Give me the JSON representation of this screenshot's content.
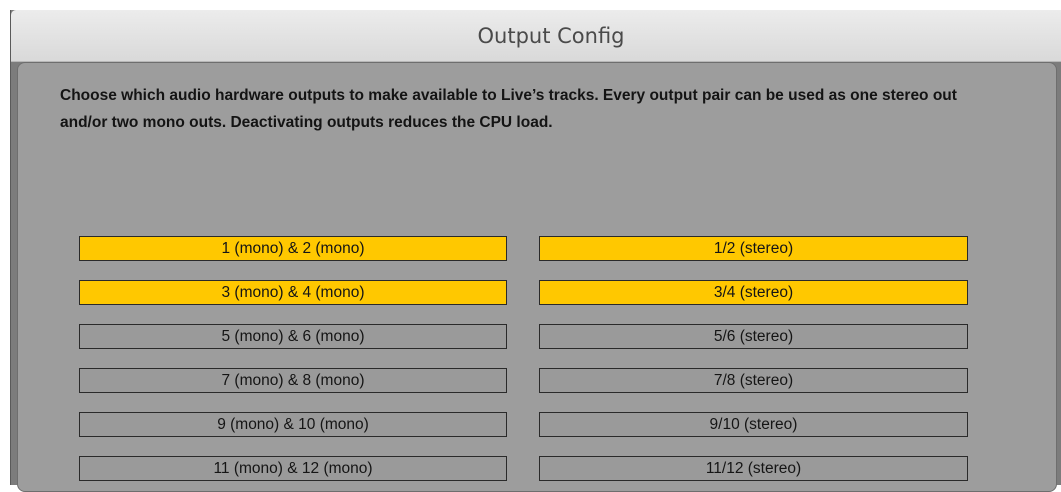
{
  "window": {
    "title": "Output Config"
  },
  "description": "Choose which audio hardware outputs to make available to Live’s tracks. Every output pair can be used as one stereo out and/or two mono outs.  Deactivating outputs reduces the CPU load.",
  "colors": {
    "active": "#ffc800",
    "inactive": "#9a9a9a",
    "panel": "#9d9d9d"
  },
  "outputs": [
    {
      "mono": {
        "label": "1 (mono) & 2 (mono)",
        "active": true
      },
      "stereo": {
        "label": "1/2 (stereo)",
        "active": true
      }
    },
    {
      "mono": {
        "label": "3 (mono) & 4 (mono)",
        "active": true
      },
      "stereo": {
        "label": "3/4 (stereo)",
        "active": true
      }
    },
    {
      "mono": {
        "label": "5 (mono) & 6 (mono)",
        "active": false
      },
      "stereo": {
        "label": "5/6 (stereo)",
        "active": false
      }
    },
    {
      "mono": {
        "label": "7 (mono) & 8 (mono)",
        "active": false
      },
      "stereo": {
        "label": "7/8 (stereo)",
        "active": false
      }
    },
    {
      "mono": {
        "label": "9 (mono) & 10 (mono)",
        "active": false
      },
      "stereo": {
        "label": "9/10 (stereo)",
        "active": false
      }
    },
    {
      "mono": {
        "label": "11 (mono) & 12 (mono)",
        "active": false
      },
      "stereo": {
        "label": "11/12 (stereo)",
        "active": false
      }
    }
  ]
}
